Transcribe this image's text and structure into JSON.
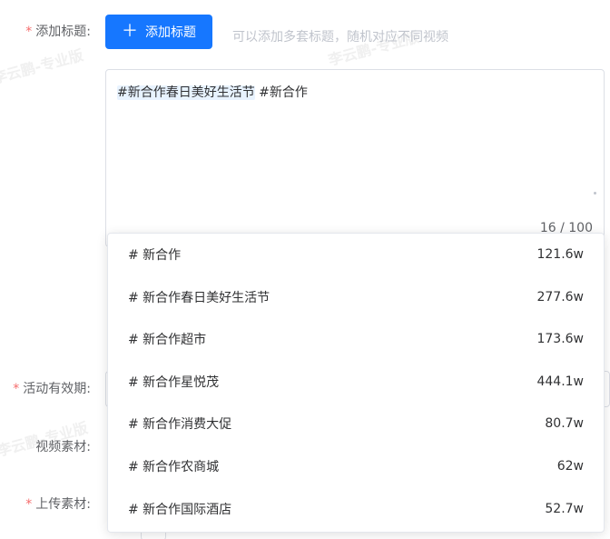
{
  "form": {
    "title_label": "添加标题:",
    "validity_label": "活动有效期:",
    "video_label": "视频素材:",
    "upload_label": "上传素材:",
    "required_mark": "*"
  },
  "add_title_button": {
    "plus": "＋",
    "label": "添加标题"
  },
  "hint": "可以添加多套标题，随机对应不同视频",
  "textarea": {
    "highlighted_tag": "#新合作春日美好生活节",
    "rest_text": " #新合作",
    "counter": "16 / 100"
  },
  "suggestions": [
    {
      "tag": "# 新合作",
      "count": "121.6w"
    },
    {
      "tag": "# 新合作春日美好生活节",
      "count": "277.6w"
    },
    {
      "tag": "# 新合作超市",
      "count": "173.6w"
    },
    {
      "tag": "# 新合作星悦茂",
      "count": "444.1w"
    },
    {
      "tag": "# 新合作消费大促",
      "count": "80.7w"
    },
    {
      "tag": "# 新合作农商城",
      "count": "62w"
    },
    {
      "tag": "# 新合作国际酒店",
      "count": "52.7w"
    }
  ],
  "watermark": "李云鹏-专业版",
  "colors": {
    "primary": "#1677ff",
    "required": "#f56c6c",
    "hint": "#c0c4cc",
    "highlight_bg": "#e8f3ff"
  }
}
